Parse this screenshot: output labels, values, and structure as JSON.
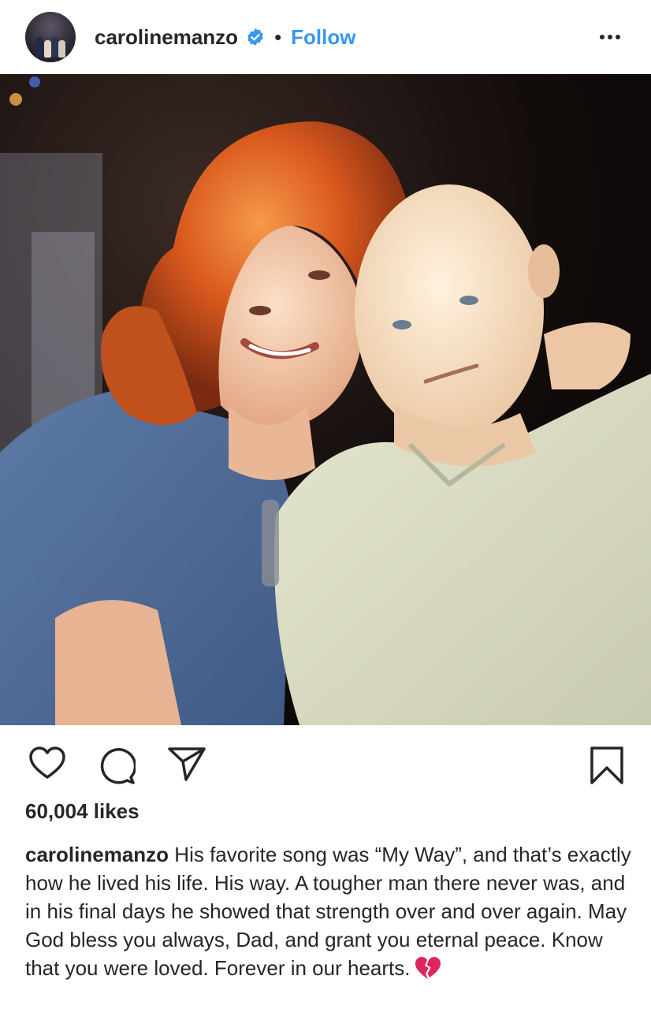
{
  "post": {
    "username": "carolinemanzo",
    "separator": "•",
    "follow_label": "Follow",
    "likes": "60,004 likes",
    "caption_username": "carolinemanzo",
    "caption_text": "His favorite song was “My Way”, and that’s exactly how he lived his life. His way. A tougher man there never was, and in his final days he showed that strength over and over again. May God bless you always, Dad, and grant you eternal peace. Know that you were loved. Forever in our hearts."
  },
  "icons": {
    "verified": "verified-badge-icon",
    "more": "more-options-icon",
    "like": "heart-icon",
    "comment": "comment-icon",
    "share": "share-icon",
    "save": "bookmark-icon",
    "emoji": "broken-heart-emoji"
  },
  "colors": {
    "text": "#262626",
    "link_blue": "#3897f0",
    "verified_blue": "#3897f0",
    "broken_heart": "#e0245e"
  }
}
